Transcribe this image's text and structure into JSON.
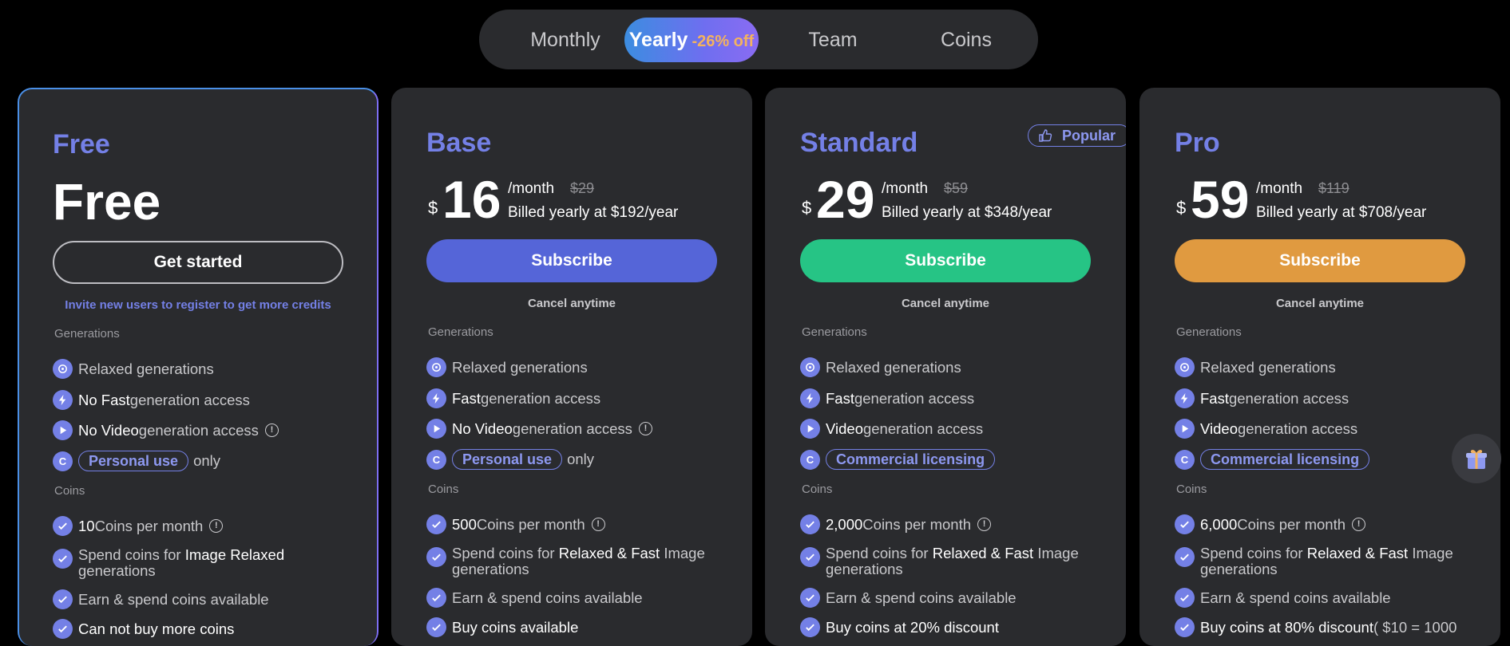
{
  "tabs": [
    {
      "label": "Monthly"
    },
    {
      "label": "Yearly",
      "badge": "-26% off"
    },
    {
      "label": "Team"
    },
    {
      "label": "Coins"
    }
  ],
  "colors": {
    "accent": "#7480e6",
    "base": "#5565d8",
    "standard": "#26c485",
    "pro": "#e09a40"
  },
  "plans": {
    "free": {
      "name": "Free",
      "big": "Free",
      "button": "Get started",
      "note": "Invite new users to register to get more credits",
      "gen_label": "Generations",
      "f1": "Relaxed generations",
      "f2_hl": "No Fast",
      "f2": " generation access",
      "f3_hl": "No Video",
      "f3": " generation access",
      "pill": "Personal use",
      "pill_after": "only",
      "coins_label": "Coins",
      "c1_hl": "10",
      "c1": " Coins per month",
      "c2_a": "Spend coins for ",
      "c2_hl": "Image Relaxed",
      "c2_b": " generations",
      "c3": "Earn & spend coins available",
      "c4": "Can not buy more coins"
    },
    "base": {
      "name": "Base",
      "currency": "$",
      "price": "16",
      "per": "/month",
      "old": "$29",
      "billed": "Billed yearly at $192/year",
      "button": "Subscribe",
      "note": "Cancel anytime",
      "gen_label": "Generations",
      "f1": "Relaxed generations",
      "f2_hl": "Fast",
      "f2": " generation access",
      "f3_hl": "No Video",
      "f3": " generation access",
      "pill": "Personal use",
      "pill_after": "only",
      "coins_label": "Coins",
      "c1_hl": "500",
      "c1": " Coins per month",
      "c2_a": "Spend coins for ",
      "c2_hl": "Relaxed & Fast",
      "c2_b": " Image generations",
      "c3": "Earn & spend coins available",
      "c4": "Buy coins available"
    },
    "standard": {
      "name": "Standard",
      "badge": "Popular",
      "currency": "$",
      "price": "29",
      "per": "/month",
      "old": "$59",
      "billed": "Billed yearly at $348/year",
      "button": "Subscribe",
      "note": "Cancel anytime",
      "gen_label": "Generations",
      "f1": "Relaxed generations",
      "f2_hl": "Fast",
      "f2": " generation access",
      "f3_hl": "Video",
      "f3": " generation access",
      "pill": "Commercial licensing",
      "pill_after": "",
      "coins_label": "Coins",
      "c1_hl": "2,000",
      "c1": " Coins per month",
      "c2_a": "Spend coins for ",
      "c2_hl": "Relaxed & Fast",
      "c2_b": " Image generations",
      "c3": "Earn & spend coins available",
      "c4": "Buy coins at 20% discount"
    },
    "pro": {
      "name": "Pro",
      "currency": "$",
      "price": "59",
      "per": "/month",
      "old": "$119",
      "billed": "Billed yearly at $708/year",
      "button": "Subscribe",
      "note": "Cancel anytime",
      "gen_label": "Generations",
      "f1": "Relaxed generations",
      "f2_hl": "Fast",
      "f2": " generation access",
      "f3_hl": "Video",
      "f3": " generation access",
      "pill": "Commercial licensing",
      "pill_after": "",
      "coins_label": "Coins",
      "c1_hl": "6,000",
      "c1": " Coins per month",
      "c2_a": "Spend coins for ",
      "c2_hl": "Relaxed & Fast",
      "c2_b": " Image generations",
      "c3": "Earn & spend coins available",
      "c4_hl": "Buy coins at 80% discount",
      "c4": " ( $10 = 1000"
    }
  },
  "info_glyph": "!",
  "coin_glyph": "C"
}
